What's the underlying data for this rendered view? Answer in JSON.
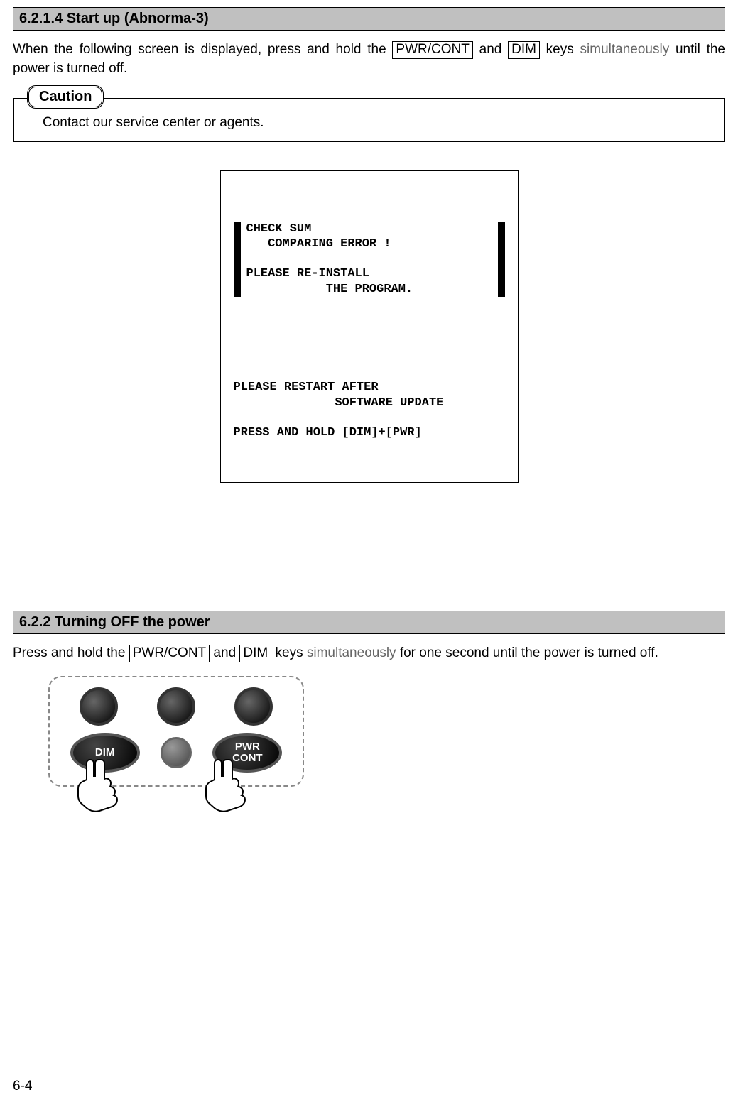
{
  "section1": {
    "heading": "6.2.1.4 Start up (Abnorma-3)",
    "para_prefix": "When the following screen is displayed, press and hold the ",
    "key1": "PWR/CONT",
    "mid1": " and ",
    "key2": "DIM",
    "mid2": " keys ",
    "faded": "simultaneously",
    "suffix": " until the power is turned off."
  },
  "caution": {
    "label": "Caution",
    "text": "Contact our service center or agents."
  },
  "screen": {
    "top": "CHECK SUM\n   COMPARING ERROR !\n\nPLEASE RE-INSTALL\n           THE PROGRAM.",
    "bottom": "PLEASE RESTART AFTER\n              SOFTWARE UPDATE\n\nPRESS AND HOLD [DIM]+[PWR]"
  },
  "section2": {
    "heading": "6.2.2 Turning OFF the power",
    "para_prefix": "Press and hold the ",
    "key1": "PWR/CONT",
    "mid1": " and ",
    "key2": "DIM",
    "mid2": " keys ",
    "faded": "simultaneously",
    "suffix": " for one second until the power is turned off."
  },
  "device": {
    "dim_label": "DIM",
    "pwr_label_l1": "PWR",
    "pwr_label_l2": "CONT"
  },
  "footer": {
    "page": "6-4"
  }
}
